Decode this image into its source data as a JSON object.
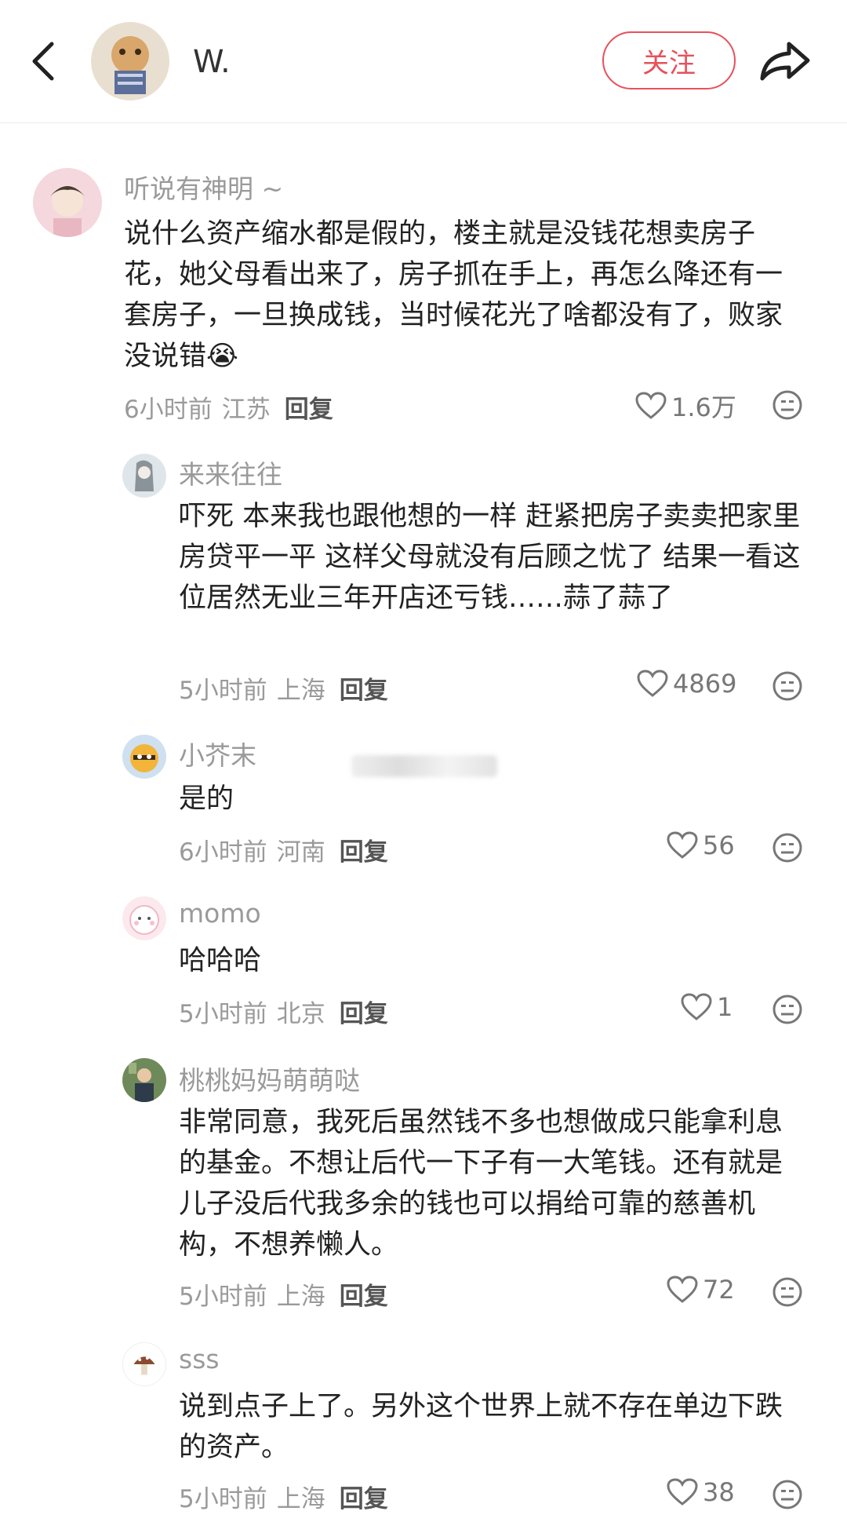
{
  "header": {
    "author": "W.",
    "follow_label": "关注"
  },
  "comments": [
    {
      "name": "听说有神明 ~",
      "text": "说什么资产缩水都是假的，楼主就是没钱花想卖房子花，她父母看出来了，房子抓在手上，再怎么降还有一套房子，一旦换成钱，当时候花光了啥都没有了，败家没说错",
      "emoji": "😭",
      "time": "6小时前",
      "location": "江苏",
      "reply": "回复",
      "likes": "1.6万"
    },
    {
      "name": "来来往往",
      "text": "吓死 本来我也跟他想的一样 赶紧把房子卖卖把家里房贷平一平 这样父母就没有后顾之忧了 结果一看这位居然无业三年开店还亏钱……蒜了蒜了",
      "time": "5小时前",
      "location": "上海",
      "reply": "回复",
      "likes": "4869"
    },
    {
      "name": "小芥末",
      "text": "是的",
      "time": "6小时前",
      "location": "河南",
      "reply": "回复",
      "likes": "56"
    },
    {
      "name": "momo",
      "text": "哈哈哈",
      "time": "5小时前",
      "location": "北京",
      "reply": "回复",
      "likes": "1"
    },
    {
      "name": "桃桃妈妈萌萌哒",
      "text": "非常同意，我死后虽然钱不多也想做成只能拿利息的基金。不想让后代一下子有一大笔钱。还有就是儿子没后代我多余的钱也可以捐给可靠的慈善机构，不想养懒人。",
      "time": "5小时前",
      "location": "上海",
      "reply": "回复",
      "likes": "72"
    },
    {
      "name": "sss",
      "text": "说到点子上了。另外这个世界上就不存在单边下跌的资产。",
      "time": "5小时前",
      "location": "上海",
      "reply": "回复",
      "likes": "38"
    }
  ],
  "icons": {
    "back": "chevron-left-icon",
    "share": "share-arrow-icon",
    "like": "heart-outline-icon",
    "dislike": "meh-face-icon"
  },
  "colors": {
    "accent": "#e8505b",
    "muted": "#9a9a9a"
  }
}
